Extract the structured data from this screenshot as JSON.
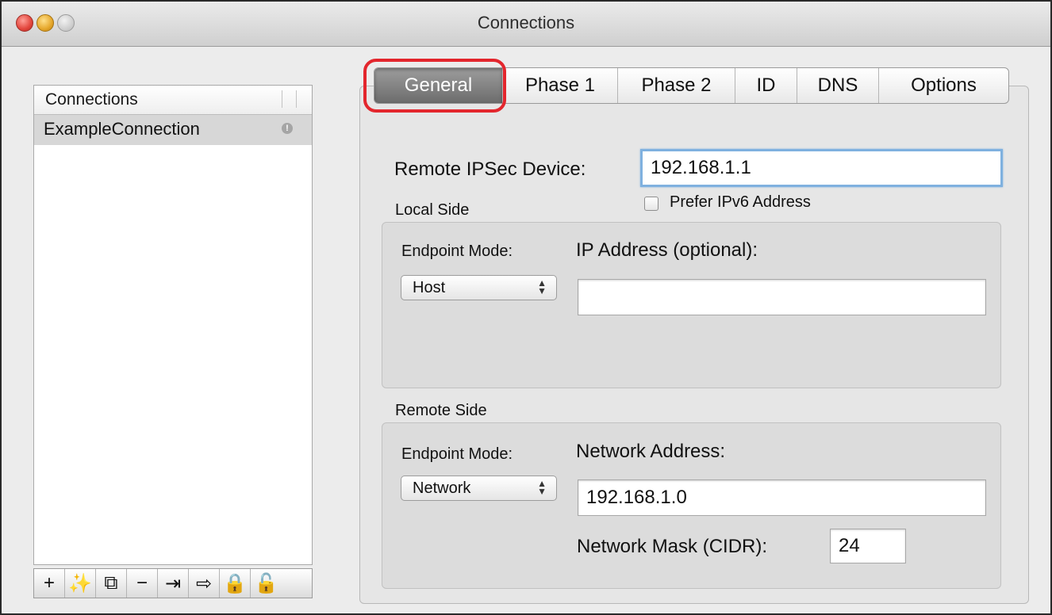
{
  "window": {
    "title": "Connections"
  },
  "list": {
    "header": "Connections",
    "items": [
      {
        "label": "ExampleConnection",
        "status_icon": "warning-icon"
      }
    ],
    "toolbar": [
      {
        "name": "add-icon",
        "glyph": "+",
        "enabled": true
      },
      {
        "name": "wizard-icon",
        "glyph": "✨",
        "enabled": true
      },
      {
        "name": "duplicate-icon",
        "glyph": "⧉",
        "enabled": true
      },
      {
        "name": "remove-icon",
        "glyph": "−",
        "enabled": true
      },
      {
        "name": "import-icon",
        "glyph": "⇥",
        "enabled": true
      },
      {
        "name": "export-icon",
        "glyph": "⇨",
        "enabled": true
      },
      {
        "name": "lock-icon",
        "glyph": "🔒",
        "enabled": true
      },
      {
        "name": "unlock-icon",
        "glyph": "🔓",
        "enabled": false
      }
    ]
  },
  "tabs": {
    "items": [
      "General",
      "Phase 1",
      "Phase 2",
      "ID",
      "DNS",
      "Options"
    ],
    "active": "General"
  },
  "general": {
    "remote_device_label": "Remote IPSec Device:",
    "remote_device_value": "192.168.1.1",
    "prefer_ipv6_label": "Prefer IPv6 Address",
    "prefer_ipv6_checked": false,
    "local_side": {
      "title": "Local Side",
      "endpoint_mode_label": "Endpoint Mode:",
      "endpoint_mode_value": "Host",
      "ip_address_label": "IP Address (optional):",
      "ip_address_value": ""
    },
    "remote_side": {
      "title": "Remote Side",
      "endpoint_mode_label": "Endpoint Mode:",
      "endpoint_mode_value": "Network",
      "network_address_label": "Network Address:",
      "network_address_value": "192.168.1.0",
      "network_mask_label": "Network Mask (CIDR):",
      "network_mask_value": "24"
    }
  },
  "colors": {
    "highlight": "#e3262d",
    "focus_ring": "#7fb1df",
    "active_tab": "#7a7a7a"
  }
}
